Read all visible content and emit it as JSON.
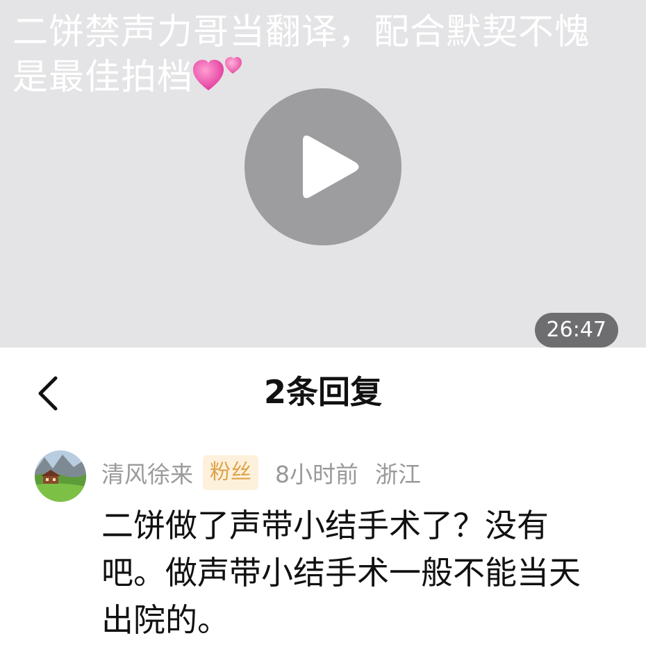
{
  "video": {
    "caption": "二饼禁声力哥当翻译，配合默契不愧是最佳拍档",
    "hearts_icon": "two-hearts-icon",
    "play_icon": "play-icon",
    "duration": "26:47",
    "colors": {
      "background": "#e4e4e6",
      "play_circle": "#9d9d9f",
      "duration_badge": "#6e6e70"
    }
  },
  "header": {
    "back_icon": "chevron-left-icon",
    "title": "2条回复"
  },
  "comment": {
    "avatar": "avatar-landscape-image",
    "username": "清风徐来",
    "badge": "粉丝",
    "time": "8小时前",
    "location": "浙江",
    "text": "二饼做了声带小结手术了？没有吧。做声带小结手术一般不能当天出院的。",
    "colors": {
      "badge_bg": "#fdf1dc",
      "badge_text": "#dfa24a",
      "meta_text": "#999999",
      "body_text": "#111111"
    }
  }
}
